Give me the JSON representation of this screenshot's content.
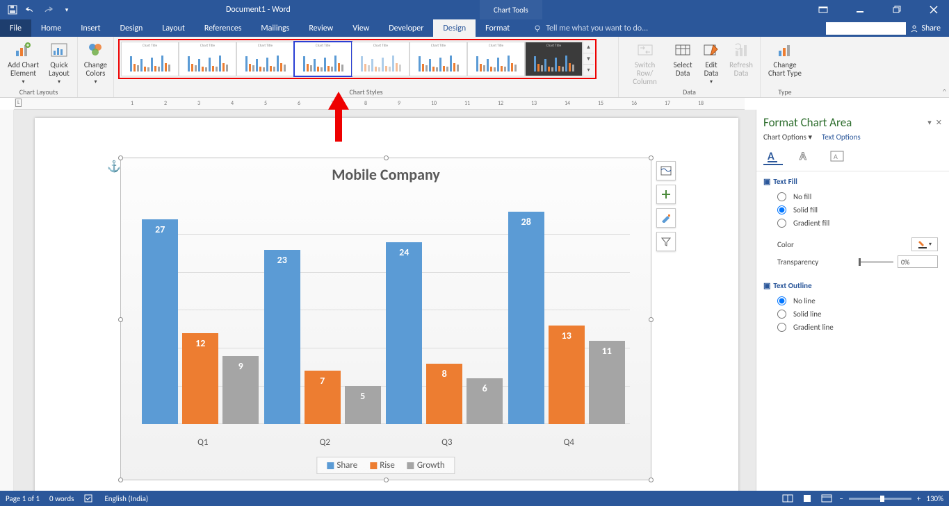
{
  "titlebar": {
    "doc_title": "Document1 - Word",
    "chart_tools": "Chart Tools",
    "share": "Share"
  },
  "tabs": {
    "file": "File",
    "home": "Home",
    "insert": "Insert",
    "design_doc": "Design",
    "layout": "Layout",
    "references": "References",
    "mailings": "Mailings",
    "review": "Review",
    "view": "View",
    "developer": "Developer",
    "design_chart": "Design",
    "format": "Format",
    "tellme": "Tell me what you want to do..."
  },
  "ribbon": {
    "chart_layouts": {
      "add_element": "Add Chart Element",
      "quick_layout": "Quick Layout",
      "group": "Chart Layouts"
    },
    "change_colors": "Change Colors",
    "chart_styles_group": "Chart Styles",
    "style_thumb_title": "Chart Title",
    "data": {
      "switch": "Switch Row/ Column",
      "select": "Select Data",
      "edit": "Edit Data",
      "refresh": "Refresh Data",
      "group": "Data"
    },
    "type": {
      "change": "Change Chart Type",
      "group": "Type"
    }
  },
  "chart_data": {
    "type": "bar",
    "title": "Mobile Company",
    "categories": [
      "Q1",
      "Q2",
      "Q3",
      "Q4"
    ],
    "series": [
      {
        "name": "Share",
        "values": [
          27,
          23,
          24,
          28
        ],
        "color": "#5b9bd5"
      },
      {
        "name": "Rise",
        "values": [
          12,
          7,
          8,
          13
        ],
        "color": "#ed7d31"
      },
      {
        "name": "Growth",
        "values": [
          9,
          5,
          6,
          11
        ],
        "color": "#a5a5a5"
      }
    ],
    "ylim": [
      0,
      30
    ],
    "legend_position": "bottom"
  },
  "format_pane": {
    "title": "Format Chart Area",
    "chart_options": "Chart Options",
    "text_options": "Text Options",
    "text_fill": {
      "header": "Text Fill",
      "no_fill": "No fill",
      "solid_fill": "Solid fill",
      "gradient_fill": "Gradient fill",
      "selected": "solid",
      "color_label": "Color",
      "transparency_label": "Transparency",
      "transparency_value": "0%"
    },
    "text_outline": {
      "header": "Text Outline",
      "no_line": "No line",
      "solid_line": "Solid line",
      "gradient_line": "Gradient line",
      "selected": "none"
    }
  },
  "statusbar": {
    "page": "Page 1 of 1",
    "words": "0 words",
    "language": "English (India)",
    "zoom": "130%"
  }
}
